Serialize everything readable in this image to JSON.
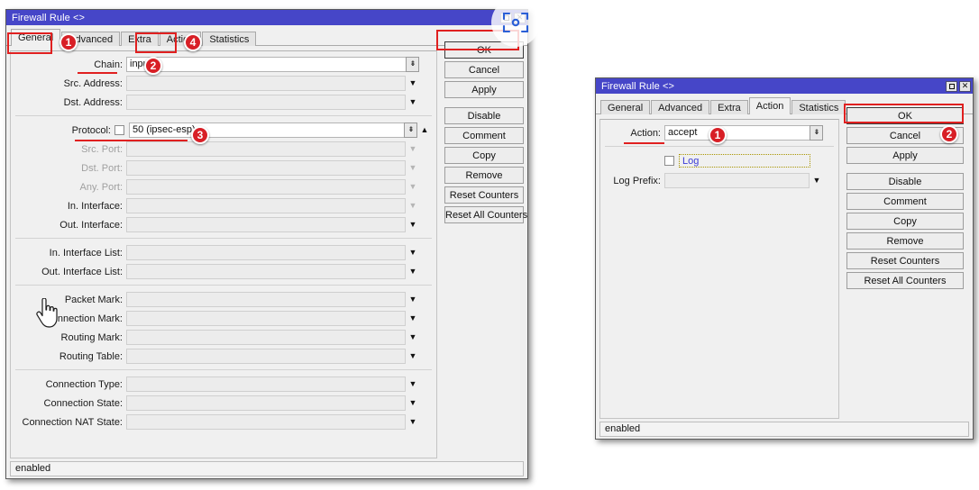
{
  "left_dialog": {
    "title": "Firewall Rule <>",
    "tabs": [
      {
        "label": "General",
        "active": true
      },
      {
        "label": "Advanced",
        "active": false
      },
      {
        "label": "Extra",
        "active": false
      },
      {
        "label": "Action",
        "active": false
      },
      {
        "label": "Statistics",
        "active": false
      }
    ],
    "fields": [
      {
        "label": "Chain:",
        "value": "input",
        "style": "white",
        "dropdown": "box",
        "dim": false
      },
      {
        "label": "Src. Address:",
        "value": "",
        "style": "dim",
        "dropdown": "plain",
        "dim": false
      },
      {
        "label": "Dst. Address:",
        "value": "",
        "style": "dim",
        "dropdown": "plain",
        "dim": false
      },
      {
        "label": "Protocol:",
        "value": "50 (ipsec-esp)",
        "style": "white",
        "dropdown": "box",
        "dim": false,
        "checkbox": true,
        "extra_arrow": "up"
      },
      {
        "label": "Src. Port:",
        "value": "",
        "style": "dim",
        "dropdown": "plain",
        "dim": true
      },
      {
        "label": "Dst. Port:",
        "value": "",
        "style": "dim",
        "dropdown": "plain",
        "dim": true
      },
      {
        "label": "Any. Port:",
        "value": "",
        "style": "dim",
        "dropdown": "plain",
        "dim": true
      },
      {
        "label": "In. Interface:",
        "value": "",
        "style": "dim",
        "dropdown": "plain",
        "dim": false
      },
      {
        "label": "Out. Interface:",
        "value": "",
        "style": "dim",
        "dropdown": "plain",
        "dim": false
      },
      {
        "label": "In. Interface List:",
        "value": "",
        "style": "dim",
        "dropdown": "plain",
        "dim": false
      },
      {
        "label": "Out. Interface List:",
        "value": "",
        "style": "dim",
        "dropdown": "plain",
        "dim": false
      },
      {
        "label": "Packet Mark:",
        "value": "",
        "style": "dim",
        "dropdown": "plain",
        "dim": false
      },
      {
        "label": "Connection Mark:",
        "value": "",
        "style": "dim",
        "dropdown": "plain",
        "dim": false
      },
      {
        "label": "Routing Mark:",
        "value": "",
        "style": "dim",
        "dropdown": "plain",
        "dim": false
      },
      {
        "label": "Routing Table:",
        "value": "",
        "style": "dim",
        "dropdown": "plain",
        "dim": false
      },
      {
        "label": "Connection Type:",
        "value": "",
        "style": "dim",
        "dropdown": "plain",
        "dim": false
      },
      {
        "label": "Connection State:",
        "value": "",
        "style": "dim",
        "dropdown": "plain",
        "dim": false
      },
      {
        "label": "Connection NAT State:",
        "value": "",
        "style": "dim",
        "dropdown": "plain",
        "dim": false
      }
    ],
    "buttons": [
      {
        "label": "OK",
        "default": true
      },
      {
        "label": "Cancel",
        "default": false
      },
      {
        "label": "Apply",
        "default": false
      },
      {
        "label": "Disable",
        "default": false
      },
      {
        "label": "Comment",
        "default": false
      },
      {
        "label": "Copy",
        "default": false
      },
      {
        "label": "Remove",
        "default": false
      },
      {
        "label": "Reset Counters",
        "default": false
      },
      {
        "label": "Reset All Counters",
        "default": false
      }
    ],
    "status": "enabled",
    "badges": [
      "1",
      "2",
      "3",
      "4"
    ],
    "window_buttons": {
      "restore": "restore-icon",
      "close": "✕"
    }
  },
  "right_dialog": {
    "title": "Firewall Rule <>",
    "tabs": [
      {
        "label": "General",
        "active": false
      },
      {
        "label": "Advanced",
        "active": false
      },
      {
        "label": "Extra",
        "active": false
      },
      {
        "label": "Action",
        "active": true
      },
      {
        "label": "Statistics",
        "active": false
      }
    ],
    "action_label": "Action:",
    "action_value": "accept",
    "log_label": "Log",
    "log_prefix_label": "Log Prefix:",
    "log_prefix_value": "",
    "buttons": [
      {
        "label": "OK",
        "default": true
      },
      {
        "label": "Cancel",
        "default": false
      },
      {
        "label": "Apply",
        "default": false
      },
      {
        "label": "Disable",
        "default": false
      },
      {
        "label": "Comment",
        "default": false
      },
      {
        "label": "Copy",
        "default": false
      },
      {
        "label": "Remove",
        "default": false
      },
      {
        "label": "Reset Counters",
        "default": false
      },
      {
        "label": "Reset All Counters",
        "default": false
      }
    ],
    "status": "enabled",
    "badges": [
      "1",
      "2"
    ],
    "window_buttons": {
      "restore": "restore-icon",
      "close": "✕"
    }
  },
  "colors": {
    "titlebar": "#4646c8",
    "annotation": "#e02020",
    "badge": "#d81f26",
    "face": "#f0f0f0",
    "link": "#3b3bd6"
  },
  "glyphs": {
    "down": "▼",
    "up": "▲",
    "combo": "⤓",
    "close": "✕"
  }
}
